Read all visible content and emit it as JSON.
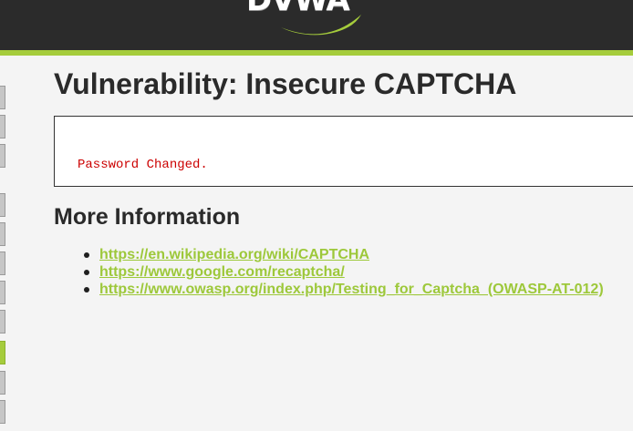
{
  "header": {
    "logo_text": "DVWA",
    "accent_color": "#a5cc3c",
    "bar_color": "#2b2b2b"
  },
  "sidebar": {
    "tabs": [
      {
        "active": false
      },
      {
        "active": false
      },
      {
        "active": false
      },
      {
        "active": false
      },
      {
        "active": false
      },
      {
        "active": false
      },
      {
        "active": false
      },
      {
        "active": false
      },
      {
        "active": true
      },
      {
        "active": false
      },
      {
        "active": false
      }
    ]
  },
  "main": {
    "title": "Vulnerability: Insecure CAPTCHA",
    "message": "Password Changed.",
    "message_color": "#cc0000",
    "more_info_heading": "More Information",
    "links": [
      "https://en.wikipedia.org/wiki/CAPTCHA",
      "https://www.google.com/recaptcha/",
      "https://www.owasp.org/index.php/Testing_for_Captcha_(OWASP-AT-012)"
    ],
    "link_color": "#9dc83a"
  }
}
